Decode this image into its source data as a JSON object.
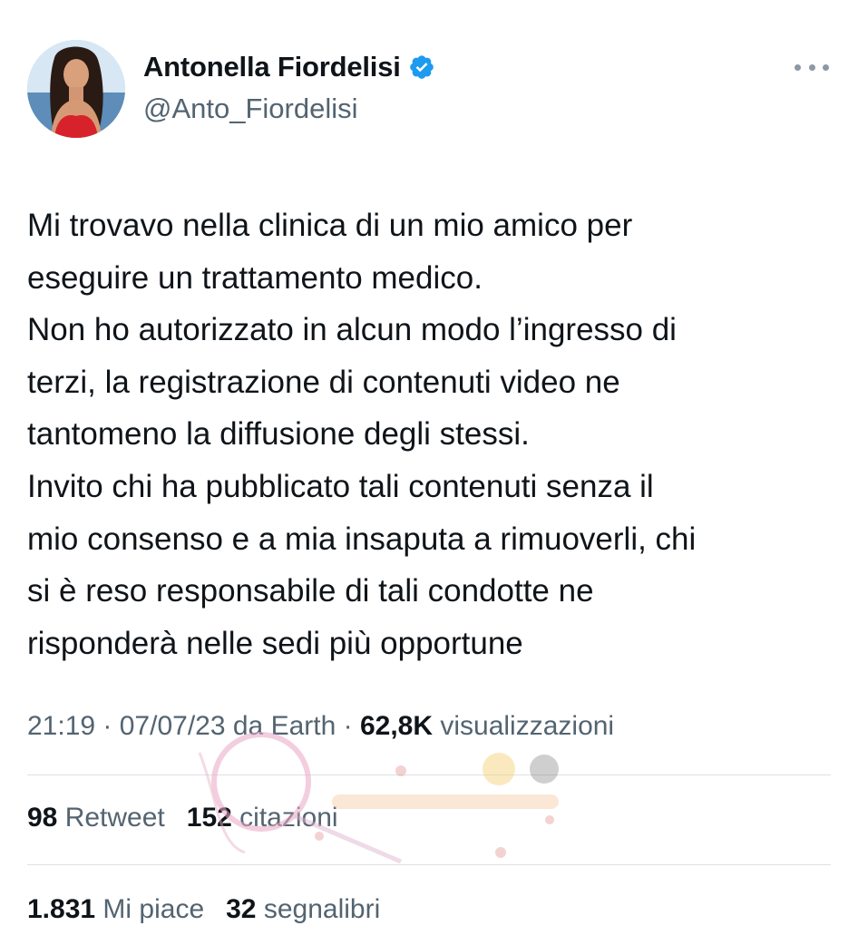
{
  "author": {
    "display_name": "Antonella Fiordelisi",
    "handle": "@Anto_Fiordelisi",
    "verified_icon": "verified-badge-icon",
    "avatar_icon": "profile-photo"
  },
  "more_icon": "more-horizontal-icon",
  "tweet": {
    "text": "Mi trovavo nella clinica di un mio amico per\neseguire un trattamento medico.\nNon ho autorizzato in alcun modo l’ingresso di\nterzi, la registrazione di contenuti video ne\ntantomeno la diffusione degli stessi.\nInvito chi ha pubblicato tali contenuti senza il\nmio consenso e a mia insaputa a rimuoverli, chi\nsi è reso responsabile di tali condotte ne\nrisponderà nelle sedi più opportune"
  },
  "meta": {
    "time": "21:19",
    "sep1": " · ",
    "date": "07/07/23",
    "source": " da Earth",
    "sep2": " · ",
    "views_count": "62,8K",
    "views_label": " visualizzazioni"
  },
  "stats": {
    "retweets_count": "98",
    "retweets_label": " Retweet",
    "quotes_count": "152",
    "quotes_label": " citazioni",
    "likes_count": "1.831",
    "likes_label": " Mi piace",
    "bookmarks_count": "32",
    "bookmarks_label": " segnalibri"
  },
  "colors": {
    "text": "#0f1419",
    "secondary": "#536471",
    "verified": "#1d9bf0",
    "divider": "#dbe1e6"
  }
}
